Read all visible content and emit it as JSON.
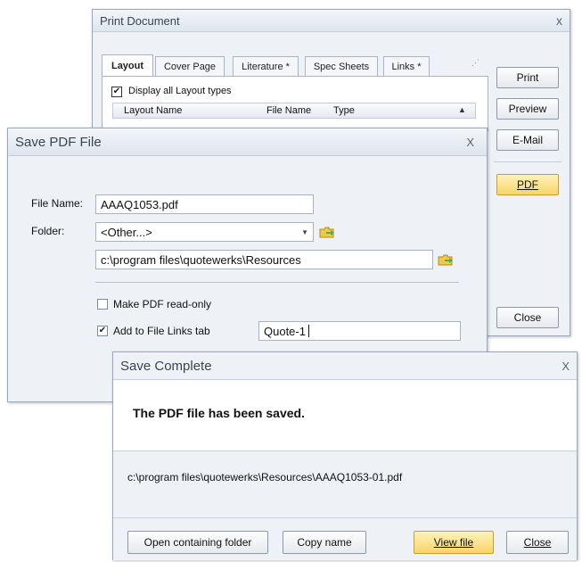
{
  "print_document": {
    "title": "Print Document",
    "close_glyph": "x",
    "tabs": [
      "Layout",
      "Cover Page",
      "Literature *",
      "Spec Sheets",
      "Links *"
    ],
    "display_all_label": "Display all Layout types",
    "display_all_checked": "✔",
    "columns": [
      "Layout Name",
      "File Name",
      "Type"
    ],
    "buttons": {
      "print": "Print",
      "preview": "Preview",
      "email": "E-Mail",
      "pdf": "PDF",
      "close": "Close"
    }
  },
  "save_pdf": {
    "title": "Save PDF File",
    "close_glyph": "X",
    "file_name_label": "File Name:",
    "file_name_value": "AAAQ1053.pdf",
    "folder_label": "Folder:",
    "folder_select_value": "<Other...>",
    "folder_path": "c:\\program files\\quotewerks\\Resources",
    "readonly_label": "Make PDF read-only",
    "add_links_label": "Add to File Links tab",
    "add_links_checked": "✔",
    "links_name_value": "Quote-1"
  },
  "save_complete": {
    "title": "Save Complete",
    "close_glyph": "X",
    "message": "The PDF file has been saved.",
    "saved_path": "c:\\program files\\quotewerks\\Resources\\AAAQ1053-01.pdf",
    "buttons": {
      "open_folder": "Open containing folder",
      "copy_name": "Copy name",
      "view_file": "View file",
      "close": "Close"
    }
  },
  "colors": {
    "accent_button": "#f7d46a",
    "window_bg": "#eef2f7",
    "title_text": "#3a4450"
  },
  "icons": {
    "folder": "folder-browse-icon",
    "dropdown": "chevron-down-icon"
  }
}
